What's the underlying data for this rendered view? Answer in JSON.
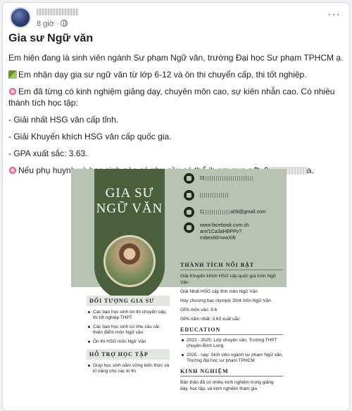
{
  "post": {
    "timestamp": "8 giờ ·",
    "title": "Gia sư Ngữ văn",
    "paragraphs": {
      "p1": "Em hiện đang là sinh viên ngành Sư phạm Ngữ văn, trường Đại học Sư phạm TPHCM ạ.",
      "p2": "Em nhận dạy gia sư ngữ văn từ lớp 6-12 và ôn thi chuyển cấp, thi tốt nghiệp.",
      "p3": "Em đã từng có kinh nghiệm giảng dạy, chuyên môn cao, sự kiên nhẫn cao. Có nhiều thành tích học tập:",
      "b1": "- Giải nhất HSG văn cấp tỉnh.",
      "b2": "- Giải Khuyến khích HSG văn cấp quốc gia.",
      "b3": "- GPA xuất sắc: 3.63.",
      "p4_start": "Nếu phụ huynh và học sinh nào có nhu cầu có thể ib em qua sđt: 0",
      "p4_end": "a."
    },
    "icons": {
      "avatar": "avatar",
      "globe": "globe-icon",
      "more": "more-options-icon"
    },
    "more_glyph": "···"
  },
  "flyer": {
    "title_line1": "GIA SƯ",
    "title_line2": "NGỮ VĂN",
    "contact": {
      "name_partial": "D",
      "email_partial": "C",
      "email_end": "a09@gmail.com",
      "facebook": "www.facebook.com.sh are/1Ca3aHBPPv?mibextid=wwXIfr"
    },
    "achievements_heading": "THÀNH TÍCH NỔI BẬT",
    "achievements": [
      "Giải Khuyến khích HSG cấp quốc gia môn Ngữ Văn",
      "Giải Nhất HSG cấp tỉnh môn Ngữ Văn",
      "Huy chương bạc olympic 30/4 môn Ngữ Văn",
      "GPA môn văn: 9.6",
      "GPA năm nhất: 3.63 xuất sắc"
    ],
    "education_heading": "EDUCATION",
    "education": [
      "2022 - 2025: Lớp chuyên văn, Trường THPT chuyên Bình Long",
      "2025 - nay: Sinh viên ngành sư phạm Ngữ văn, Trường đại học sư phạm TPHCM"
    ],
    "experience_heading": "KINH NGHIỆM",
    "experience_text": "Bản thân đã có nhiều kinh nghiệm trong giảng dạy, học tập, và kinh nghiệm tham gia",
    "target_heading": "ĐỐI TƯỢNG GIA SƯ",
    "target": [
      "Các bạn học sinh ôn thi chuyển cấp, thi tốt nghiệp THPT",
      "Các bạn học sinh có nhu cầu cải thiện điểm môn Ngữ văn",
      "Ôn thi HSG môn Ngữ Văn"
    ],
    "support_heading": "HỖ TRỢ HỌC TẬP",
    "support": [
      "Giúp học sinh nắm vững kiến thức và kĩ năng cho các kì thi"
    ]
  }
}
